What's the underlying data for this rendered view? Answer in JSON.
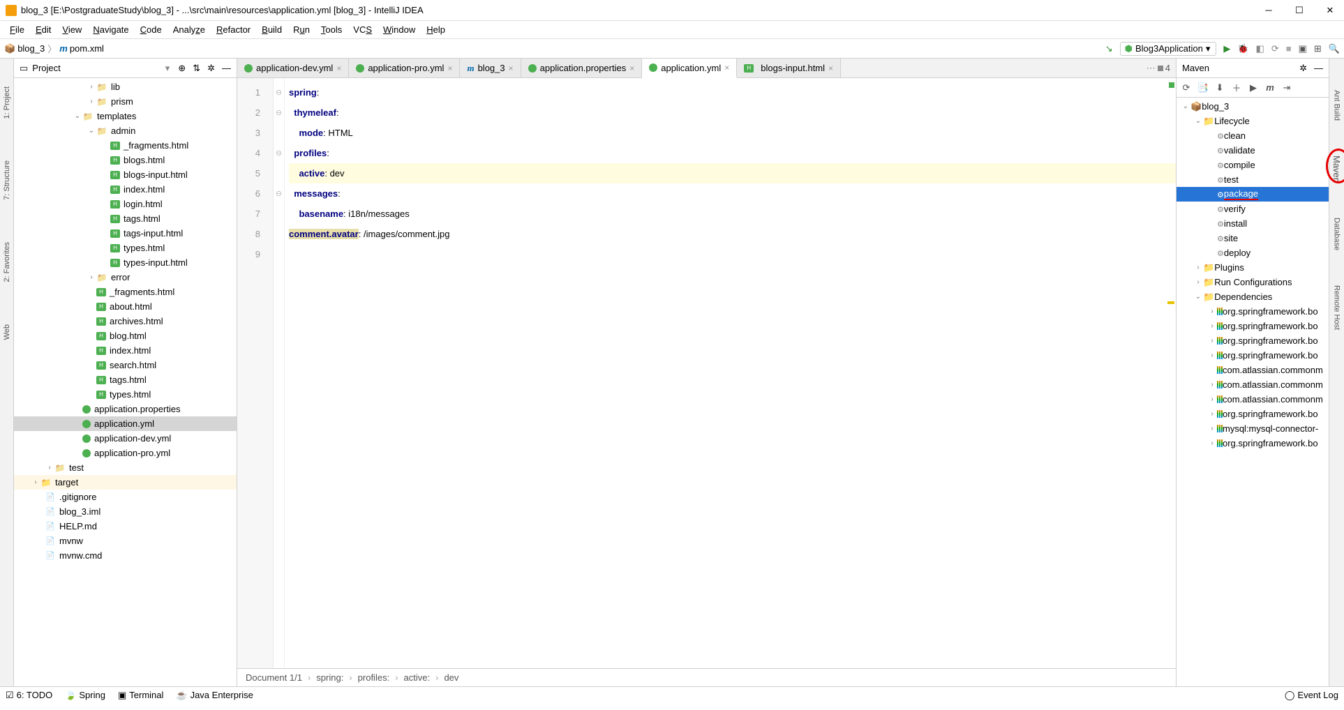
{
  "titlebar": {
    "text": "blog_3 [E:\\PostgraduateStudy\\blog_3] - ...\\src\\main\\resources\\application.yml [blog_3] - IntelliJ IDEA"
  },
  "menus": [
    "File",
    "Edit",
    "View",
    "Navigate",
    "Code",
    "Analyze",
    "Refactor",
    "Build",
    "Run",
    "Tools",
    "VCS",
    "Window",
    "Help"
  ],
  "navbar": {
    "crumb1": "blog_3",
    "crumb2": "pom.xml",
    "run_config": "Blog3Application",
    "tab_count": "4"
  },
  "project_panel": {
    "title": "Project"
  },
  "tree": {
    "lib": "lib",
    "prism": "prism",
    "templates": "templates",
    "admin": "admin",
    "fragments": "_fragments.html",
    "blogs": "blogs.html",
    "blogsinput": "blogs-input.html",
    "index": "index.html",
    "login": "login.html",
    "tags": "tags.html",
    "tagsinput": "tags-input.html",
    "types": "types.html",
    "typesinput": "types-input.html",
    "error": "error",
    "r_fragments": "_fragments.html",
    "about": "about.html",
    "archives": "archives.html",
    "blog": "blog.html",
    "r_index": "index.html",
    "search": "search.html",
    "r_tags": "tags.html",
    "r_types": "types.html",
    "appprops": "application.properties",
    "appyml": "application.yml",
    "appdev": "application-dev.yml",
    "apppro": "application-pro.yml",
    "test": "test",
    "target": "target",
    "gitignore": ".gitignore",
    "iml": "blog_3.iml",
    "help": "HELP.md",
    "mvnw": "mvnw",
    "mvnwcmd": "mvnw.cmd"
  },
  "tabs": {
    "t1": "application-dev.yml",
    "t2": "application-pro.yml",
    "t3": "blog_3",
    "t4": "application.properties",
    "t5": "application.yml",
    "t6": "blogs-input.html"
  },
  "code": {
    "l1a": "spring",
    "l1b": ":",
    "l2a": "thymeleaf",
    "l2b": ":",
    "l3a": "mode",
    "l3b": ": ",
    "l3c": "HTML",
    "l4a": "profiles",
    "l4b": ":",
    "l5a": "active",
    "l5b": ": ",
    "l5c": "dev",
    "l6a": "messages",
    "l6b": ":",
    "l7a": "basename",
    "l7b": ": ",
    "l7c": "i18n/messages",
    "l8a": "comment.avatar",
    "l8b": ": ",
    "l8c": "/images/comment.jpg"
  },
  "breadcrumb_bar": {
    "doc": "Document 1/1",
    "b1": "spring:",
    "b2": "profiles:",
    "b3": "active:",
    "b4": "dev"
  },
  "maven": {
    "title": "Maven",
    "project": "blog_3",
    "lifecycle": "Lifecycle",
    "clean": "clean",
    "validate": "validate",
    "compile": "compile",
    "test": "test",
    "package": "package",
    "verify": "verify",
    "install": "install",
    "site": "site",
    "deploy": "deploy",
    "plugins": "Plugins",
    "runconfigs": "Run Configurations",
    "deps": "Dependencies",
    "d1": "org.springframework.bo",
    "d2": "org.springframework.bo",
    "d3": "org.springframework.bo",
    "d4": "org.springframework.bo",
    "d5": "com.atlassian.commonm",
    "d6": "com.atlassian.commonm",
    "d7": "com.atlassian.commonm",
    "d8": "org.springframework.bo",
    "d9": "mysql:mysql-connector-",
    "d10": "org.springframework.bo"
  },
  "right_strip": {
    "l1": "Ant Build",
    "l2": "Maven",
    "l3": "Database",
    "l4": "Remote Host"
  },
  "left_strip": {
    "l1": "1: Project",
    "l2": "7: Structure",
    "l3": "2: Favorites",
    "l4": "Web"
  },
  "bottom": {
    "todo": "6: TODO",
    "spring": "Spring",
    "terminal": "Terminal",
    "jee": "Java Enterprise",
    "eventlog": "Event Log"
  }
}
